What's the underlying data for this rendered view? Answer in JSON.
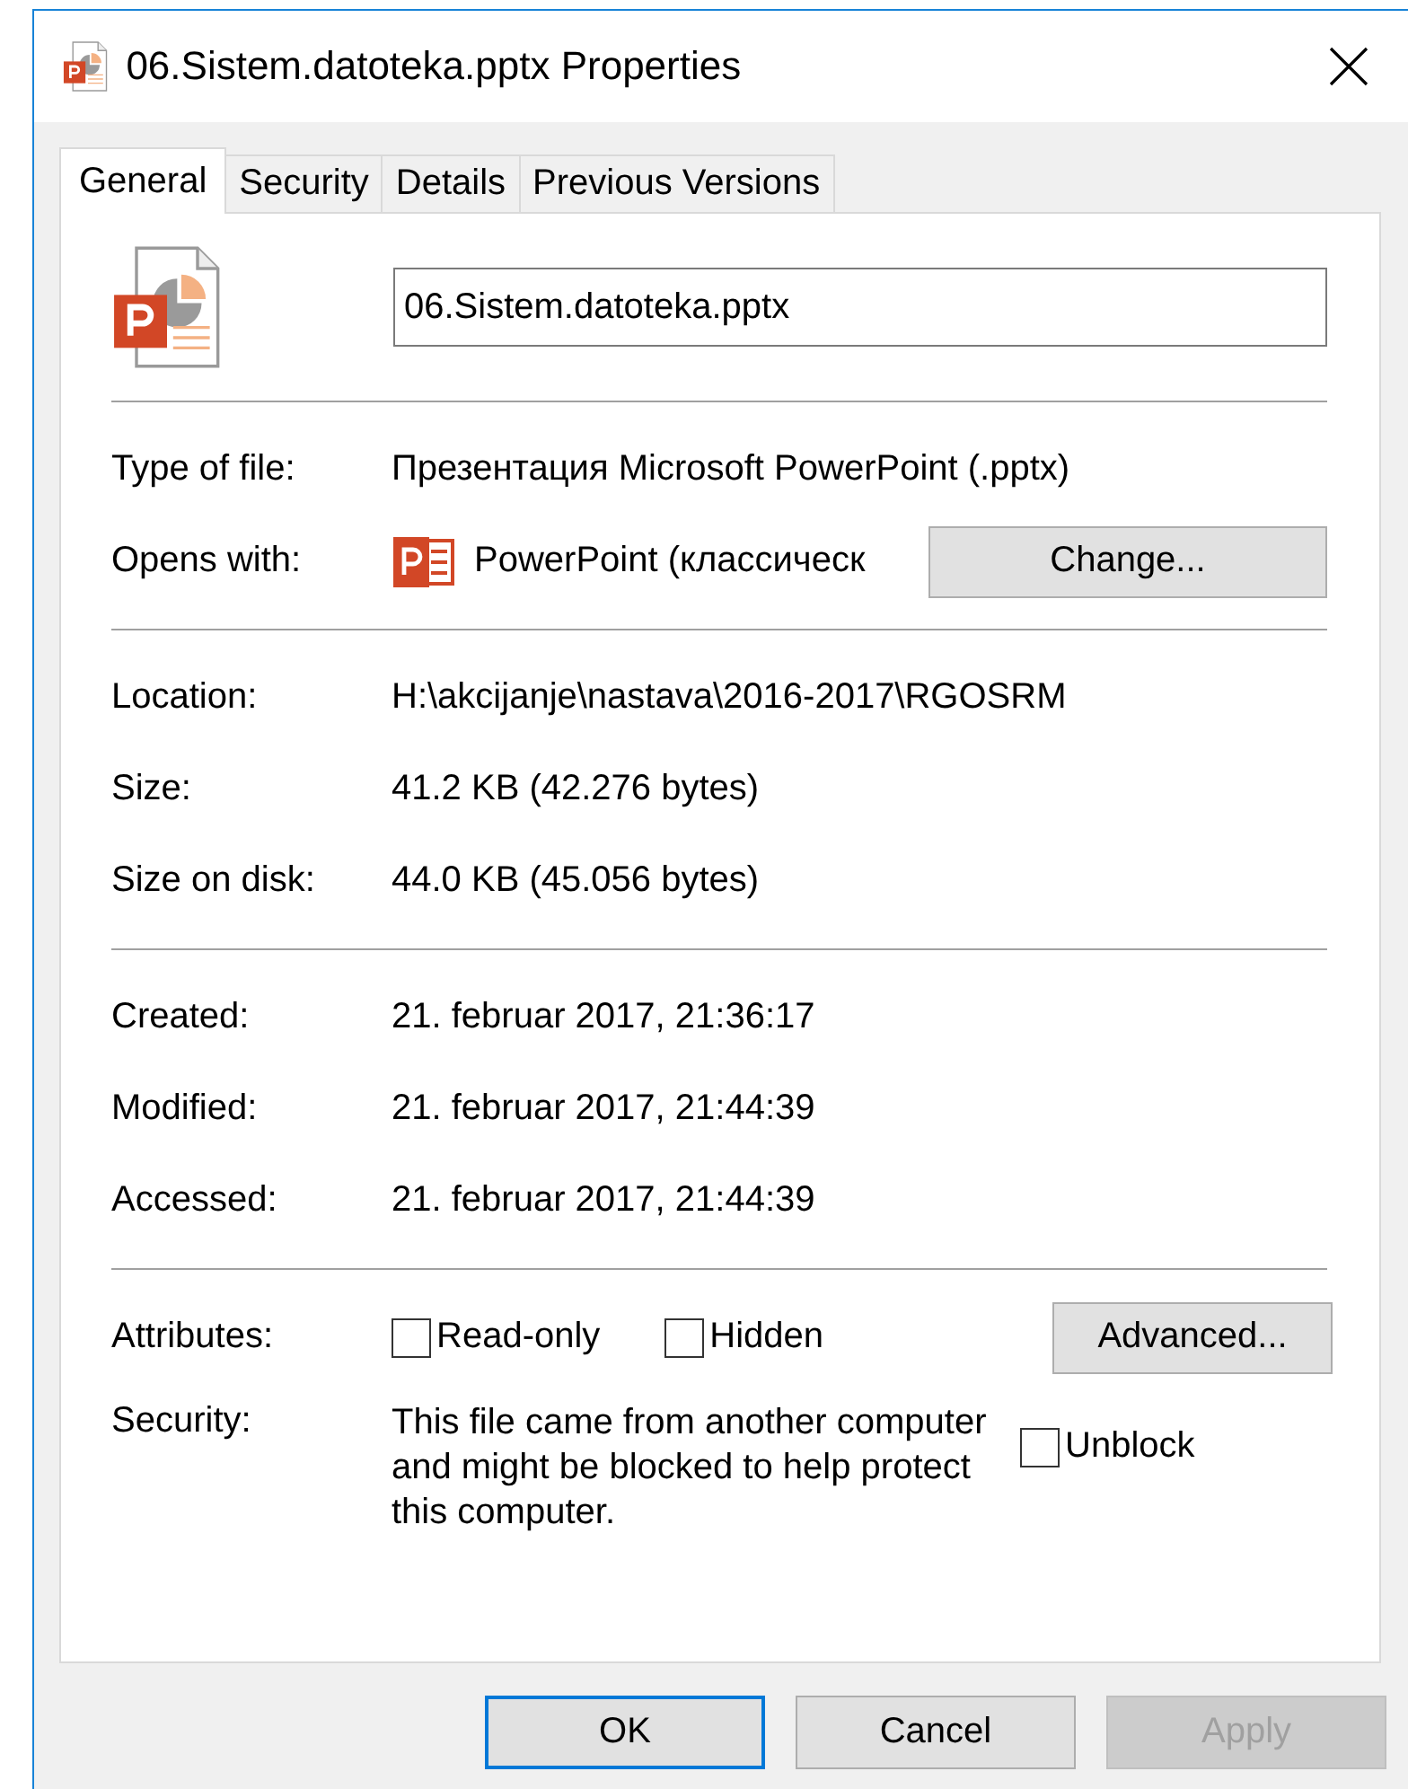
{
  "window": {
    "title": "06.Sistem.datoteka.pptx Properties"
  },
  "tabs": [
    {
      "label": "General",
      "selected": true
    },
    {
      "label": "Security",
      "selected": false
    },
    {
      "label": "Details",
      "selected": false
    },
    {
      "label": "Previous Versions",
      "selected": false
    }
  ],
  "file_name": {
    "value": "06.Sistem.datoteka.pptx"
  },
  "type_of_file": {
    "label": "Type of file:",
    "value": "Презентация Microsoft PowerPoint (.pptx)"
  },
  "opens_with": {
    "label": "Opens with:",
    "value": "PowerPoint (классическ",
    "button": "Change..."
  },
  "groups": [
    [
      {
        "label": "Location:",
        "value": "H:\\akcijanje\\nastava\\2016-2017\\RGOSRM"
      },
      {
        "label": "Size:",
        "value": "41.2 KB (42.276 bytes)"
      },
      {
        "label": "Size on disk:",
        "value": "44.0 KB (45.056 bytes)"
      }
    ],
    [
      {
        "label": "Created:",
        "value": "21. februar 2017, 21:36:17"
      },
      {
        "label": "Modified:",
        "value": "21. februar 2017, 21:44:39"
      },
      {
        "label": "Accessed:",
        "value": "21. februar 2017, 21:44:39"
      }
    ]
  ],
  "attributes": {
    "label": "Attributes:",
    "options": [
      {
        "label": "Read-only",
        "checked": false
      },
      {
        "label": "Hidden",
        "checked": false
      }
    ],
    "button": "Advanced..."
  },
  "security": {
    "label": "Security:",
    "text": "This file came from another computer and might be blocked to help protect this computer.",
    "option": {
      "label": "Unblock",
      "checked": false
    }
  },
  "buttons": [
    {
      "label": "OK",
      "default": true,
      "disabled": false
    },
    {
      "label": "Cancel",
      "default": false,
      "disabled": false
    },
    {
      "label": "Apply",
      "default": false,
      "disabled": true
    }
  ]
}
